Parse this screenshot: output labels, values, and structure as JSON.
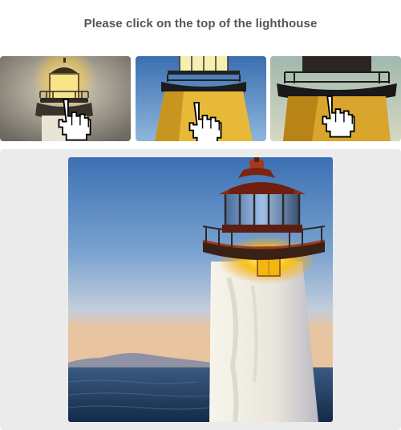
{
  "prompt": {
    "text": "Please click on the top of the lighthouse"
  },
  "examples": [
    {
      "icon": "pointer-hand-icon",
      "subject": "lighthouse-lantern"
    },
    {
      "icon": "pointer-hand-icon",
      "subject": "lighthouse-lantern"
    },
    {
      "icon": "pointer-hand-icon",
      "subject": "lighthouse-lantern"
    }
  ],
  "task": {
    "subject": "lighthouse",
    "colors": {
      "sky_top": "#3c70b4",
      "sky_bottom": "#e8c4a0",
      "sea": "#1f3a5f",
      "lamp": "#f6c21a",
      "roof": "#8a2b16",
      "tower": "#f2f0ea"
    }
  }
}
